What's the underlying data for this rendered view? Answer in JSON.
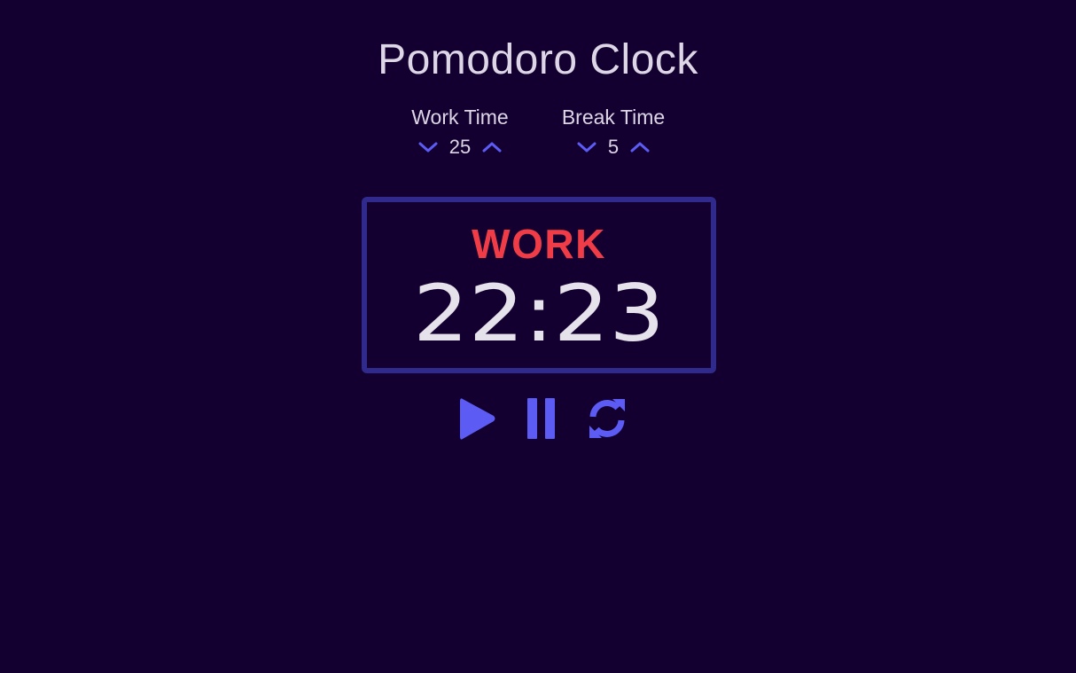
{
  "app": {
    "title": "Pomodoro Clock"
  },
  "settings": {
    "work": {
      "label": "Work Time",
      "value": "25"
    },
    "break": {
      "label": "Break Time",
      "value": "5"
    }
  },
  "timer": {
    "mode": "WORK",
    "display": "22:23"
  },
  "controls": {
    "play_icon": "play-icon",
    "pause_icon": "pause-icon",
    "reset_icon": "refresh-icon"
  },
  "colors": {
    "background": "#130030",
    "accent": "#5c5cf5",
    "mode_label": "#f03c47",
    "timer_border": "#2f2a8c",
    "text": "#dcd6e6"
  }
}
